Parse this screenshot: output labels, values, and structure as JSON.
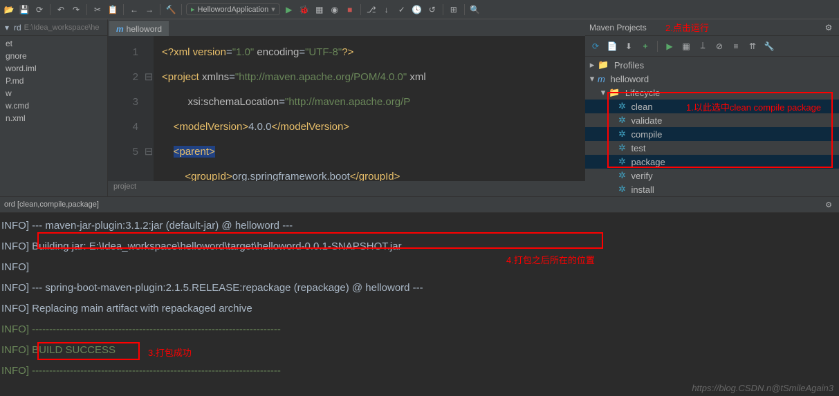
{
  "toolbar": {
    "run_config": "HellowordApplication"
  },
  "project": {
    "name": "rd",
    "path": "E:\\Idea_workspace\\he",
    "items": [
      "et",
      "gnore",
      "word.iml",
      "P.md",
      "w",
      "w.cmd",
      "n.xml"
    ]
  },
  "editor": {
    "tab_label": "helloword",
    "line_numbers": [
      "1",
      "2",
      "3",
      "4",
      "5"
    ],
    "line1_pre": "<?",
    "line1_tag": "xml version",
    "line1_eq": "=",
    "line1_v1": "\"1.0\"",
    "line1_enc": " encoding",
    "line1_v2": "\"UTF-8\"",
    "line1_end": "?>",
    "line2_open": "<",
    "line2_tag": "project ",
    "line2_attr": "xmlns",
    "line2_eq": "=",
    "line2_val": "\"http://maven.apache.org/POM/4.0.0\"",
    "line2_tail": " xml",
    "line3_attr": "xsi:schemaLocation",
    "line3_eq": "=",
    "line3_val": "\"http://maven.apache.org/P",
    "line4_open": "<",
    "line4_tag": "modelVersion",
    "line4_close": ">",
    "line4_txt": "4.0.0",
    "line4_end_open": "</",
    "line4_end_tag": "modelVersion",
    "line4_end_close": ">",
    "line5_open": "<",
    "line5_tag": "parent",
    "line5_close": ">",
    "line6_open": "<",
    "line6_tag": "groupId",
    "line6_close": ">",
    "line6_txt": "org.springframework.boot",
    "line6_end_open": "</",
    "line6_end_tag": "groupId",
    "line6_end_close": ">",
    "crumb": "project"
  },
  "maven": {
    "title": "Maven Projects",
    "profiles": "Profiles",
    "root": "helloword",
    "lifecycle_label": "Lifecycle",
    "lifecycle": [
      "clean",
      "validate",
      "compile",
      "test",
      "package",
      "verify",
      "install"
    ]
  },
  "run": {
    "title": "ord [clean,compile,package]",
    "lines": [
      "INFO] --- maven-jar-plugin:3.1.2:jar (default-jar) @ helloword ---",
      "INFO] Building jar: E:\\Idea_workspace\\helloword\\target\\helloword-0.0.1-SNAPSHOT.jar",
      "INFO]",
      "INFO] --- spring-boot-maven-plugin:2.1.5.RELEASE:repackage (repackage) @ helloword ---",
      "INFO] Replacing main artifact with repackaged archive",
      "INFO] ------------------------------------------------------------------------",
      "INFO] BUILD SUCCESS",
      "INFO] ------------------------------------------------------------------------"
    ]
  },
  "annotations": {
    "a1": "1.以此选中clean compile package",
    "a2": "2.点击运行",
    "a3": "3.打包成功",
    "a4": "4.打包之后所在的位置"
  },
  "watermark": "https://blog.CSDN.n@tSmileAgain3"
}
